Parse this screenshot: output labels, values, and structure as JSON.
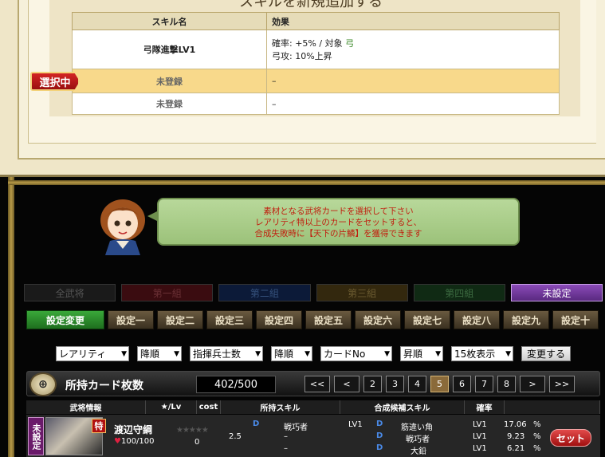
{
  "top": {
    "title_sliver": "スキルを新規追加する",
    "selected_tag": "選択中",
    "table": {
      "headers": [
        "スキル名",
        "効果"
      ],
      "rows": [
        {
          "name": "弓隊進撃LV1",
          "effect_line1_prefix": "確率: +5%  /  対象",
          "effect_line1_target": "弓",
          "effect_line2": "弓攻: 10%上昇"
        },
        {
          "name": "未登録",
          "effect": "–"
        },
        {
          "name": "未登録",
          "effect": "–"
        }
      ]
    }
  },
  "speech": {
    "lines": [
      "素材となる武将カードを選択して下さい",
      "レアリティ特以上のカードをセットすると、",
      "合成失敗時に【天下の片鱗】を獲得できます"
    ]
  },
  "group_tabs": [
    "全武将",
    "第一組",
    "第二組",
    "第三組",
    "第四組",
    "未設定"
  ],
  "presets": {
    "change_label": "設定変更",
    "items": [
      "設定一",
      "設定二",
      "設定三",
      "設定四",
      "設定五",
      "設定六",
      "設定七",
      "設定八",
      "設定九",
      "設定十"
    ]
  },
  "filters": {
    "selects": [
      "レアリティ",
      "降順",
      "指揮兵士数",
      "降順",
      "カードNo",
      "昇順",
      "15枚表示"
    ],
    "apply_label": "変更する"
  },
  "owned": {
    "label": "所持カード枚数",
    "count": "402/500",
    "pager": [
      "<<",
      "<",
      "2",
      "3",
      "4",
      "5",
      "6",
      "7",
      "8",
      ">",
      ">>"
    ],
    "current_page": "5"
  },
  "list": {
    "headers": [
      "武将情報",
      "★/Lv",
      "cost",
      "所持スキル",
      "合成候補スキル",
      "確率"
    ],
    "card": {
      "badge": "未設定",
      "rarity_mark": "特",
      "name": "渡辺守綱",
      "hp": "100/100",
      "stars": "★★★★★",
      "level": "0",
      "cost": "2.5",
      "owned_skills": [
        {
          "rank": "D",
          "name": "戦巧者",
          "lv": "LV1"
        },
        {
          "rank": "",
          "name": "–",
          "lv": ""
        },
        {
          "rank": "",
          "name": "–",
          "lv": ""
        }
      ],
      "candidate_skills": [
        {
          "rank": "D",
          "name": "筋違い角",
          "lv": "LV1",
          "rate": "17.06",
          "unit": "%"
        },
        {
          "rank": "D",
          "name": "戦巧者",
          "lv": "LV1",
          "rate": "9.23",
          "unit": "%"
        },
        {
          "rank": "D",
          "name": "大鉛",
          "lv": "LV1",
          "rate": "6.21",
          "unit": "%"
        }
      ],
      "set_label": "セット"
    }
  }
}
